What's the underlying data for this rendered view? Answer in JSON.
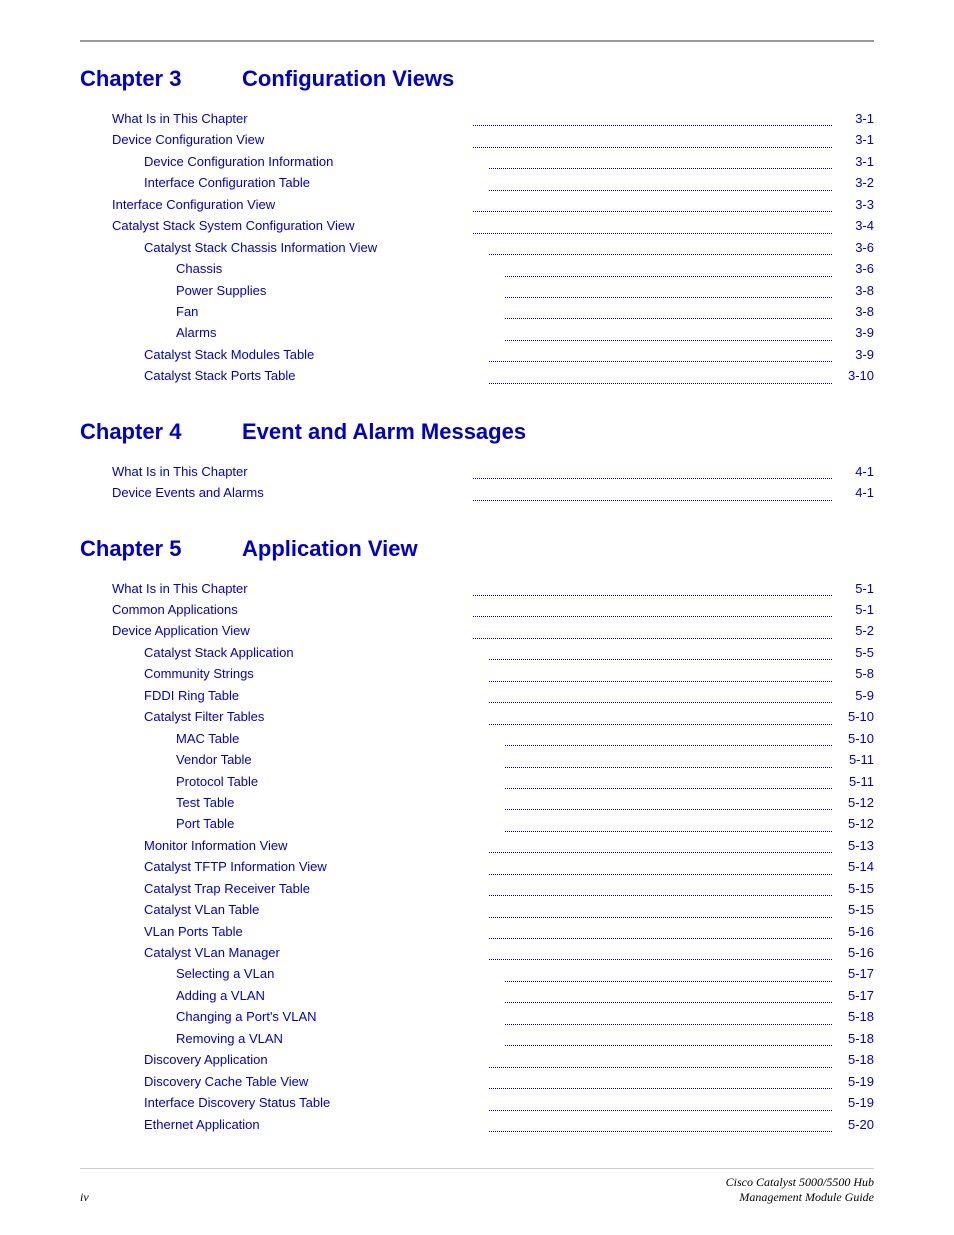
{
  "top_rule": true,
  "chapters": [
    {
      "id": "chapter3",
      "label": "Chapter 3",
      "title": "Configuration Views",
      "entries": [
        {
          "text": "What Is in This Chapter",
          "page": "3-1",
          "indent": 1
        },
        {
          "text": "Device Configuration View",
          "page": "3-1",
          "indent": 1
        },
        {
          "text": "Device Configuration Information",
          "page": "3-1",
          "indent": 2
        },
        {
          "text": "Interface Configuration Table",
          "page": "3-2",
          "indent": 2
        },
        {
          "text": "Interface Configuration View",
          "page": "3-3",
          "indent": 1
        },
        {
          "text": "Catalyst Stack System Configuration View",
          "page": "3-4",
          "indent": 1
        },
        {
          "text": "Catalyst Stack Chassis Information View",
          "page": "3-6",
          "indent": 2
        },
        {
          "text": "Chassis",
          "page": "3-6",
          "indent": 3
        },
        {
          "text": "Power Supplies",
          "page": "3-8",
          "indent": 3
        },
        {
          "text": "Fan",
          "page": "3-8",
          "indent": 3
        },
        {
          "text": "Alarms",
          "page": "3-9",
          "indent": 3
        },
        {
          "text": "Catalyst Stack Modules Table",
          "page": "3-9",
          "indent": 2
        },
        {
          "text": "Catalyst Stack Ports Table",
          "page": "3-10",
          "indent": 2
        }
      ]
    },
    {
      "id": "chapter4",
      "label": "Chapter 4",
      "title": "Event and Alarm Messages",
      "entries": [
        {
          "text": "What Is in This Chapter",
          "page": "4-1",
          "indent": 1
        },
        {
          "text": "Device Events and Alarms",
          "page": "4-1",
          "indent": 1
        }
      ]
    },
    {
      "id": "chapter5",
      "label": "Chapter 5",
      "title": "Application View",
      "entries": [
        {
          "text": "What Is in This Chapter",
          "page": "5-1",
          "indent": 1
        },
        {
          "text": "Common Applications",
          "page": "5-1",
          "indent": 1
        },
        {
          "text": "Device Application View",
          "page": "5-2",
          "indent": 1
        },
        {
          "text": "Catalyst Stack Application",
          "page": "5-5",
          "indent": 2
        },
        {
          "text": "Community Strings",
          "page": "5-8",
          "indent": 2
        },
        {
          "text": "FDDI Ring Table",
          "page": "5-9",
          "indent": 2
        },
        {
          "text": "Catalyst Filter Tables",
          "page": "5-10",
          "indent": 2
        },
        {
          "text": "MAC Table",
          "page": "5-10",
          "indent": 3
        },
        {
          "text": "Vendor Table",
          "page": "5-11",
          "indent": 3
        },
        {
          "text": "Protocol Table",
          "page": "5-11",
          "indent": 3
        },
        {
          "text": "Test Table",
          "page": "5-12",
          "indent": 3
        },
        {
          "text": "Port Table",
          "page": "5-12",
          "indent": 3
        },
        {
          "text": "Monitor Information View",
          "page": "5-13",
          "indent": 2
        },
        {
          "text": "Catalyst TFTP Information View",
          "page": "5-14",
          "indent": 2
        },
        {
          "text": "Catalyst Trap Receiver Table",
          "page": "5-15",
          "indent": 2
        },
        {
          "text": "Catalyst VLan Table",
          "page": "5-15",
          "indent": 2
        },
        {
          "text": "VLan Ports Table",
          "page": "5-16",
          "indent": 2
        },
        {
          "text": "Catalyst VLan Manager",
          "page": "5-16",
          "indent": 2
        },
        {
          "text": "Selecting a VLan",
          "page": "5-17",
          "indent": 3
        },
        {
          "text": "Adding a VLAN",
          "page": "5-17",
          "indent": 3
        },
        {
          "text": "Changing a Port's VLAN",
          "page": "5-18",
          "indent": 3
        },
        {
          "text": "Removing a VLAN",
          "page": "5-18",
          "indent": 3
        },
        {
          "text": "Discovery Application",
          "page": "5-18",
          "indent": 2
        },
        {
          "text": "Discovery Cache Table View",
          "page": "5-19",
          "indent": 2
        },
        {
          "text": "Interface Discovery Status Table",
          "page": "5-19",
          "indent": 2
        },
        {
          "text": "Ethernet Application",
          "page": "5-20",
          "indent": 2
        }
      ]
    }
  ],
  "footer": {
    "page": "iv",
    "right_line1": "Cisco Catalyst 5000/5500 Hub",
    "right_line2": "Management Module Guide"
  }
}
